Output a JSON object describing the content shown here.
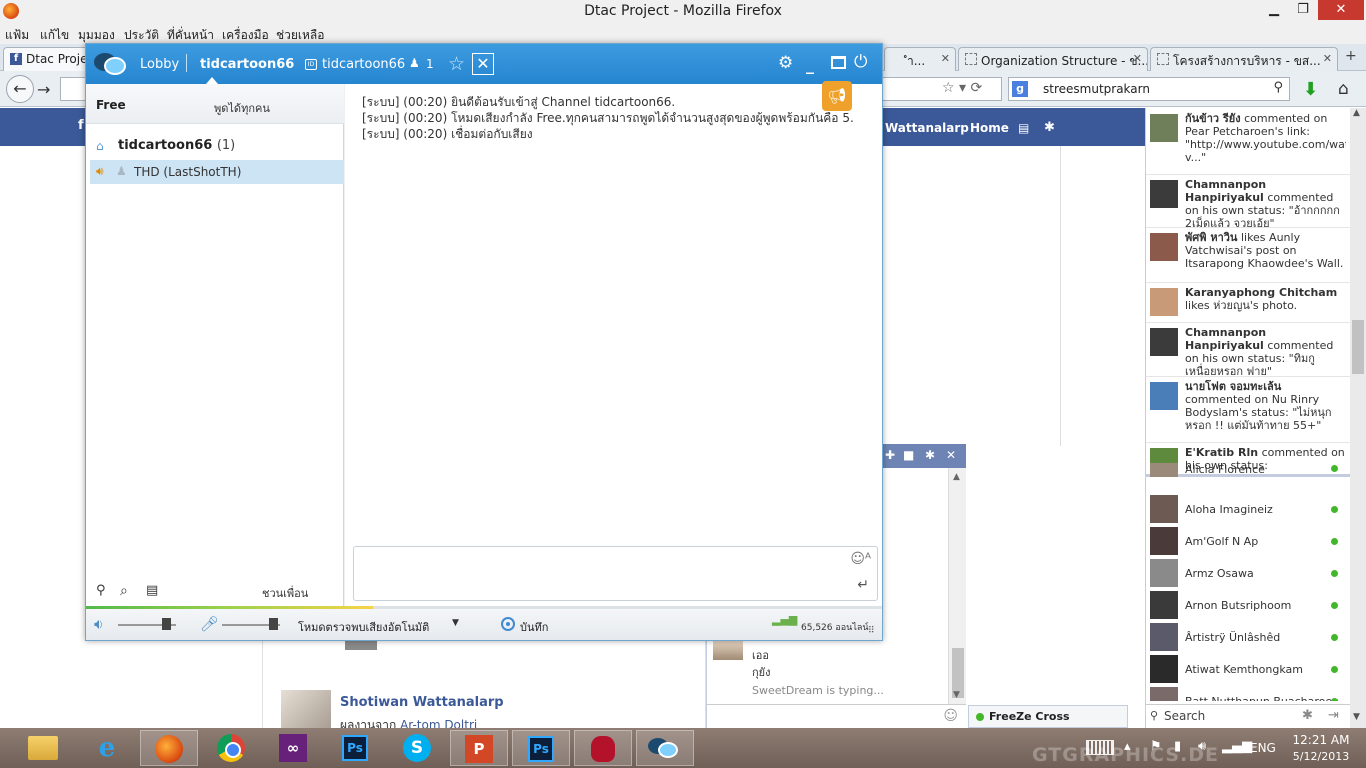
{
  "browser": {
    "window_title": "Dtac Project - Mozilla Firefox",
    "menu": [
      "แฟ้ม",
      "แก้ไข",
      "มุมมอง",
      "ประวัติ",
      "ที่คั่นหน้า",
      "เครื่องมือ",
      "ช่วยเหลือ"
    ],
    "tabs": [
      {
        "label": "Dtac Project"
      },
      {
        "label": "ำ..."
      },
      {
        "label": "Organization Structure - ข..."
      },
      {
        "label": "โครงสร้างการบริหาร - ขส..."
      }
    ],
    "search_value": "streesmutprakarn"
  },
  "facebook": {
    "nav_name": "Wattanalarp",
    "nav_home": "Home",
    "post": {
      "author": "Shotiwan Wattanalarp",
      "sub_prefix": "ผลงานจาก",
      "sub_link": "Ar-tom Doltri"
    },
    "ticker": [
      {
        "name": "กันข้าว รียัง",
        "action": "commented on Pear Petcharoen's link: \"http://www.youtube.com/watch?v...\"",
        "avatar": "#6f7f59"
      },
      {
        "name": "Chamnanpon Hanpiriyakul",
        "action": "commented on his own status: \"อ้ากกกกก 2เม็ดแล้ว จวยเอ้ย\"",
        "avatar": "#3b3b3b"
      },
      {
        "name": "พัศพิ หาวิน",
        "action": "likes Aunly Vatchwisai's post on Itsarapong Khaowdee's Wall.",
        "avatar": "#8c5a4a"
      },
      {
        "name": "Karanyaphong Chitcham",
        "action": "likes ห่วยญน's photo.",
        "avatar": "#c99a78"
      },
      {
        "name": "Chamnanpon Hanpiriyakul",
        "action": "commented on his own status: \"ทิมกูเหนื่อยหรอก ฟาย\"",
        "avatar": "#3b3b3b"
      },
      {
        "name": "นายโฟต จอมทะเล้น",
        "action": "commented on Nu Rinry Bodyslam's status: \"ไม่หนุกหรอก !! แต่มันท้าทาย 55+\"",
        "avatar": "#4a7eb8"
      },
      {
        "name": "E'Kratib Rln",
        "action": "commented on his own status:",
        "avatar": "#5d8a3d"
      }
    ],
    "friends": [
      {
        "name": "Alicia Florence"
      },
      {
        "name": "Aloha Imagineiz"
      },
      {
        "name": "Am'Golf N Ap"
      },
      {
        "name": "Armz Osawa"
      },
      {
        "name": "Arnon Butsriphoom"
      },
      {
        "name": "Ârtistrÿ Ünlâshêd"
      },
      {
        "name": "Atiwat Kemthongkam"
      },
      {
        "name": "Batt Nutthapun Buacharoen"
      }
    ],
    "sidebar_search": "Search",
    "chat": {
      "msg1": "เออ",
      "msg2": "กุยัง",
      "typing": "SweetDream is typing..."
    },
    "freeze_name": "FreeZe Cross"
  },
  "voice_app": {
    "lobby": "Lobby",
    "channel_tab": "tidcartoon66",
    "channel_id": "tidcartoon66",
    "member_count": "1",
    "mode_label": "Free",
    "mode_desc": "พูดได้ทุกคน",
    "channel_name": "tidcartoon66",
    "channel_count": "(1)",
    "user": "THD (LastShotTH)",
    "invite": "ชวนเพื่อน",
    "log": [
      "[ระบบ] (00:20) ยินดีต้อนรับเข้าสู่ Channel tidcartoon66.",
      "[ระบบ] (00:20) โหมดเสียงกำลัง Free.ทุกคนสามารถพูดได้จำนวนสูงสุดของผู้พูดพร้อมกันคือ 5.",
      "[ระบบ] (00:20) เชื่อมต่อกับเสียง"
    ],
    "voice_detect": "โหมดตรวจพบเสียงอัตโนมัติ",
    "record": "บันทึก",
    "online": "65,526 ออนไลน์",
    "speaker_level": 0.82,
    "mic_level": 0.88,
    "activity_level": 0.36
  },
  "taskbar": {
    "lang": "ENG",
    "time": "12:21 AM",
    "date": "5/12/2013"
  },
  "watermark": "GTGRAPHICS.DE"
}
